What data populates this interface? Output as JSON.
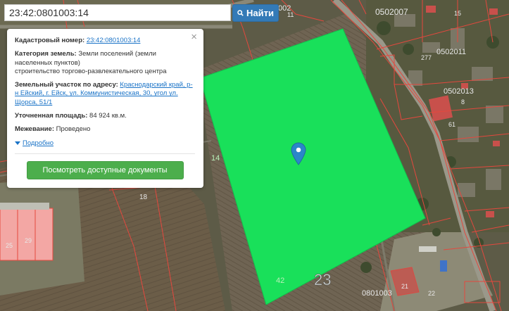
{
  "search": {
    "query": "23:42:0801003:14",
    "button_label": "Найти"
  },
  "info": {
    "cadastral_label": "Кадастровый номер:",
    "cadastral_value": "23:42:0801003:14",
    "category_label": "Категория земель:",
    "category_value": "Земли поселений (земли населенных пунктов)",
    "use_value": "строительство торгово-развлекательного центра",
    "address_label": "Земельный участок по адресу:",
    "address_value": "Краснодарский край, р-н Ейский, г. Ейск, ул. Коммунистическая, 30, угол ул. Щорса, 51/1",
    "area_label": "Уточненная площадь:",
    "area_value": "84 924 кв.м.",
    "survey_label": "Межевание:",
    "survey_value": "Проведено",
    "details_label": "Подробно",
    "docs_button": "Посмотреть доступные документы",
    "close_symbol": "×"
  },
  "map": {
    "labels": {
      "q1": "0502007",
      "q2": "0502011",
      "q3": "0502013",
      "q4": "0801003",
      "top_left": "002",
      "big_number": "23",
      "plot_42": "42",
      "plot_18": "18",
      "plot_277": "277",
      "plot_61": "61",
      "plot_25": "25",
      "plot_29": "29",
      "plot_22": "22",
      "plot_14": "14",
      "plot_11": "11",
      "plot_15": "15",
      "plot_8": "8",
      "plot_21": "21"
    },
    "colors": {
      "highlight_plot": "#19e05a",
      "parcel_border": "#e4483e",
      "marker": "#2b86c9"
    },
    "marker_icon": "map-pin-icon"
  }
}
